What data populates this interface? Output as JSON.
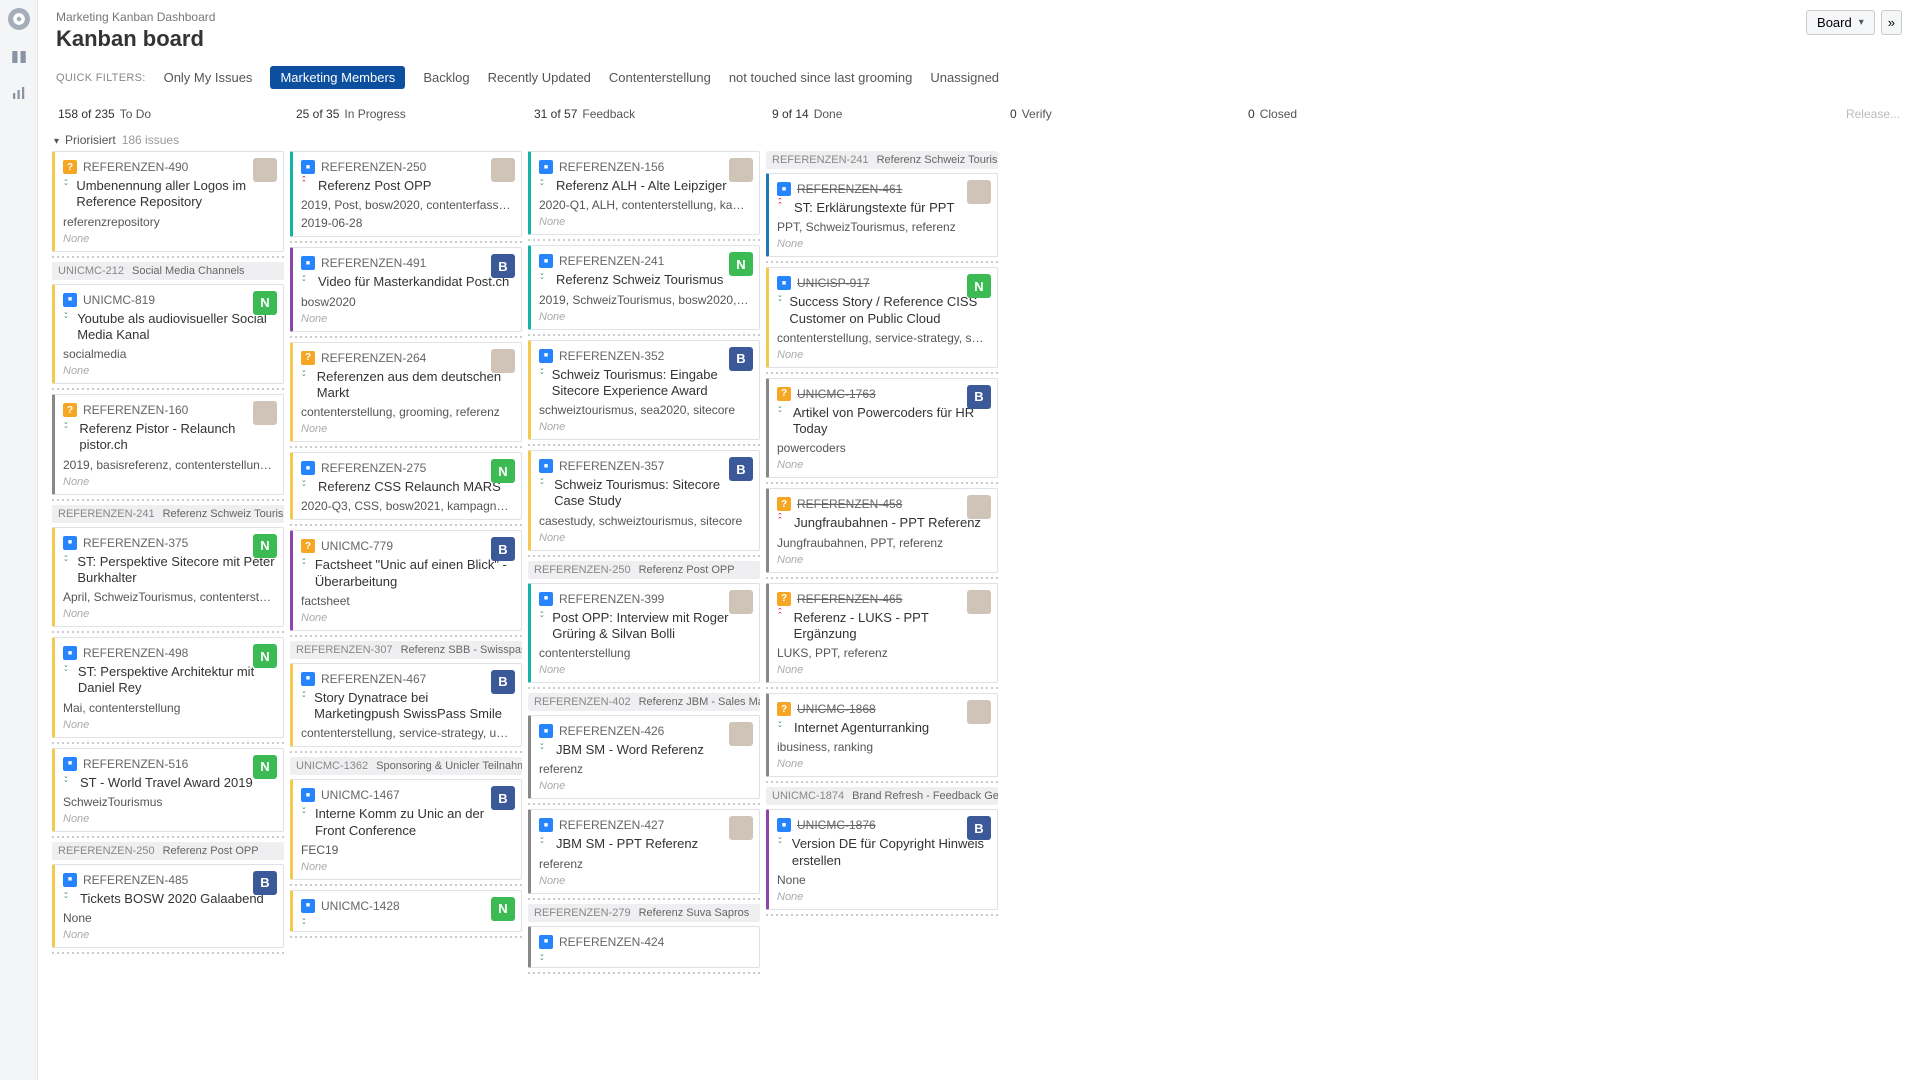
{
  "header": {
    "breadcrumb": "Marketing Kanban Dashboard",
    "title": "Kanban board",
    "board_btn": "Board",
    "expand_btn": "»"
  },
  "filters": {
    "label": "QUICK FILTERS:",
    "items": [
      "Only My Issues",
      "Marketing Members",
      "Backlog",
      "Recently Updated",
      "Contenterstellung",
      "not touched since last grooming",
      "Unassigned"
    ],
    "activeIndex": 1
  },
  "columns": [
    {
      "count": "158 of 235",
      "name": "To Do"
    },
    {
      "count": "25 of 35",
      "name": "In Progress"
    },
    {
      "count": "31 of 57",
      "name": "Feedback"
    },
    {
      "count": "9 of 14",
      "name": "Done"
    },
    {
      "count": "0",
      "name": "Verify"
    },
    {
      "count": "0",
      "name": "Closed"
    }
  ],
  "release_label": "Release...",
  "swimlane": {
    "name": "Priorisiert",
    "count": "186 issues"
  },
  "cards": {
    "c0": [
      {
        "stripe": "yellow",
        "itype": "q",
        "prio": "down",
        "key": "REFERENZEN-490",
        "summary": "Umbenennung aller Logos im Reference Repository",
        "tags": "referenzrepository",
        "none": "None",
        "av": "face"
      },
      {
        "epic": {
          "k": "UNICMC-212",
          "t": "Social Media Channels"
        }
      },
      {
        "stripe": "yellow",
        "itype": "task",
        "prio": "down",
        "key": "UNICMC-819",
        "summary": "Youtube als audiovisueller Social Media Kanal",
        "tags": "socialmedia",
        "none": "None",
        "av": "N"
      },
      {
        "stripe": "gray",
        "itype": "q",
        "prio": "down",
        "key": "REFERENZEN-160",
        "summary": "Referenz Pistor - Relaunch pistor.ch",
        "tags": "2019, basisreferenz, contenterstellung, …",
        "none": "None",
        "av": "face"
      },
      {
        "epic": {
          "k": "REFERENZEN-241",
          "t": "Referenz Schweiz Tourismus"
        }
      },
      {
        "stripe": "yellow",
        "itype": "task",
        "prio": "down",
        "key": "REFERENZEN-375",
        "summary": "ST: Perspektive Sitecore mit Peter Burkhalter",
        "tags": "April, SchweizTourismus, contenterste…",
        "none": "None",
        "av": "N"
      },
      {
        "stripe": "yellow",
        "itype": "task",
        "prio": "down",
        "key": "REFERENZEN-498",
        "summary": "ST: Perspektive Architektur mit Daniel Rey",
        "tags": "Mai, contenterstellung",
        "none": "None",
        "av": "N"
      },
      {
        "stripe": "yellow",
        "itype": "task",
        "prio": "down",
        "key": "REFERENZEN-516",
        "summary": "ST - World Travel Award 2019",
        "tags": "SchweizTourismus",
        "none": "None",
        "av": "N"
      },
      {
        "epic": {
          "k": "REFERENZEN-250",
          "t": "Referenz Post OPP"
        }
      },
      {
        "stripe": "yellow",
        "itype": "task",
        "prio": "down",
        "key": "REFERENZEN-485",
        "summary": "Tickets BOSW 2020 Galaabend",
        "tags": "None",
        "none": "None",
        "av": "B"
      }
    ],
    "c1": [
      {
        "stripe": "teal",
        "itype": "task",
        "prio": "high",
        "key": "REFERENZEN-250",
        "summary": "Referenz Post OPP",
        "tags": "2019, Post, bosw2020, contenterfassun…",
        "date": "2019-06-28",
        "av": "face"
      },
      {
        "stripe": "purple",
        "itype": "task",
        "prio": "down",
        "key": "REFERENZEN-491",
        "summary": "Video für Masterkandidat Post.ch",
        "tags": "bosw2020",
        "none": "None",
        "av": "B"
      },
      {
        "stripe": "yellow",
        "itype": "q",
        "prio": "down",
        "key": "REFERENZEN-264",
        "summary": "Referenzen aus dem deutschen Markt",
        "tags": "contenterstellung, grooming, referenz",
        "none": "None",
        "av": "face"
      },
      {
        "stripe": "yellow",
        "itype": "task",
        "prio": "down",
        "key": "REFERENZEN-275",
        "summary": "Referenz CSS Relaunch MARS",
        "tags": "2020-Q3, CSS, bosw2021, kampagnen…",
        "av": "N"
      },
      {
        "stripe": "purple",
        "itype": "q",
        "prio": "down",
        "key": "UNICMC-779",
        "summary": "Factsheet \"Unic auf einen Blick\" - Überarbeitung",
        "tags": "factsheet",
        "none": "None",
        "av": "B"
      },
      {
        "epic": {
          "k": "REFERENZEN-307",
          "t": "Referenz SBB - Swisspass - S…"
        }
      },
      {
        "stripe": "yellow",
        "itype": "task",
        "prio": "down",
        "key": "REFERENZEN-467",
        "summary": "Story Dynatrace bei Marketingpush SwissPass Smile",
        "tags": "contenterstellung, service-strategy, un…",
        "av": "B"
      },
      {
        "epic": {
          "k": "UNICMC-1362",
          "t": "Sponsoring & Unicler Teilnahme Fro…"
        }
      },
      {
        "stripe": "yellow",
        "itype": "task",
        "prio": "down",
        "key": "UNICMC-1467",
        "summary": "Interne Komm zu Unic an der Front Conference",
        "tags": "FEC19",
        "none": "None",
        "av": "B"
      },
      {
        "stripe": "yellow",
        "itype": "task",
        "prio": "down",
        "key": "UNICMC-1428",
        "summary": "",
        "av": "N"
      }
    ],
    "c2": [
      {
        "stripe": "teal",
        "itype": "task",
        "prio": "down",
        "key": "REFERENZEN-156",
        "summary": "Referenz ALH - Alte Leipziger",
        "tags": "2020-Q1, ALH, contenterstellung, kamp…",
        "none": "None",
        "av": "face"
      },
      {
        "stripe": "teal",
        "itype": "task",
        "prio": "down",
        "key": "REFERENZEN-241",
        "summary": "Referenz Schweiz Tourismus",
        "tags": "2019, SchweizTourismus, bosw2020, c…",
        "none": "None",
        "av": "N"
      },
      {
        "stripe": "yellow",
        "itype": "task",
        "prio": "down",
        "key": "REFERENZEN-352",
        "summary": "Schweiz Tourismus: Eingabe Sitecore Experience Award",
        "tags": "schweiztourismus, sea2020, sitecore",
        "none": "None",
        "av": "B"
      },
      {
        "stripe": "yellow",
        "itype": "task",
        "prio": "down",
        "key": "REFERENZEN-357",
        "summary": "Schweiz Tourismus: Sitecore Case Study",
        "tags": "casestudy, schweiztourismus, sitecore",
        "none": "None",
        "av": "B"
      },
      {
        "epic": {
          "k": "REFERENZEN-250",
          "t": "Referenz Post OPP"
        }
      },
      {
        "stripe": "teal",
        "itype": "task",
        "prio": "down",
        "key": "REFERENZEN-399",
        "summary": "Post OPP: Interview mit Roger Grüring & Silvan Bolli",
        "tags": "contenterstellung",
        "none": "None",
        "av": "face"
      },
      {
        "epic": {
          "k": "REFERENZEN-402",
          "t": "Referenz JBM - Sales Manual"
        }
      },
      {
        "stripe": "gray",
        "itype": "task",
        "prio": "down",
        "key": "REFERENZEN-426",
        "summary": "JBM SM - Word Referenz",
        "tags": "referenz",
        "none": "None",
        "av": "face"
      },
      {
        "stripe": "gray",
        "itype": "task",
        "prio": "down",
        "key": "REFERENZEN-427",
        "summary": "JBM SM - PPT Referenz",
        "tags": "referenz",
        "none": "None",
        "av": "face"
      },
      {
        "epic": {
          "k": "REFERENZEN-279",
          "t": "Referenz Suva Sapros"
        }
      },
      {
        "stripe": "gray",
        "itype": "task",
        "prio": "down",
        "key": "REFERENZEN-424",
        "summary": ""
      }
    ],
    "c3": [
      {
        "epic": {
          "k": "REFERENZEN-241",
          "t": "Referenz Schweiz Tourismus"
        }
      },
      {
        "stripe": "blue",
        "itype": "task",
        "prio": "high",
        "key": "REFERENZEN-461",
        "done": true,
        "summary": "ST: Erklärungstexte für PPT",
        "tags": "PPT, SchweizTourismus, referenz",
        "none": "None",
        "av": "face"
      },
      {
        "stripe": "yellow",
        "itype": "task",
        "prio": "down",
        "key": "UNICISP-917",
        "done": true,
        "summary": "Success Story / Reference CISS Customer on Public Cloud",
        "tags": "contenterstellung, service-strategy, so…",
        "none": "None",
        "av": "N"
      },
      {
        "stripe": "gray",
        "itype": "q",
        "prio": "down",
        "key": "UNICMC-1763",
        "done": true,
        "summary": "Artikel von Powercoders für HR Today",
        "tags": "powercoders",
        "none": "None",
        "av": "B"
      },
      {
        "stripe": "gray",
        "itype": "q",
        "prio": "high",
        "key": "REFERENZEN-458",
        "done": true,
        "summary": "Jungfraubahnen - PPT Referenz",
        "tags": "Jungfraubahnen, PPT, referenz",
        "none": "None",
        "av": "face"
      },
      {
        "stripe": "gray",
        "itype": "q",
        "prio": "high",
        "key": "REFERENZEN-465",
        "done": true,
        "summary": "Referenz - LUKS - PPT Ergänzung",
        "tags": "LUKS, PPT, referenz",
        "none": "None",
        "av": "face"
      },
      {
        "stripe": "gray",
        "itype": "q",
        "prio": "down",
        "key": "UNICMC-1868",
        "done": true,
        "summary": "Internet Agenturranking",
        "tags": "ibusiness, ranking",
        "none": "None",
        "av": "face"
      },
      {
        "epic": {
          "k": "UNICMC-1874",
          "t": "Brand Refresh - Feedback Gerrit"
        }
      },
      {
        "stripe": "purple",
        "itype": "task",
        "prio": "down",
        "key": "UNICMC-1876",
        "done": true,
        "summary": "Version DE für Copyright Hinweis erstellen",
        "tags": "None",
        "none": "None",
        "av": "B"
      }
    ]
  }
}
